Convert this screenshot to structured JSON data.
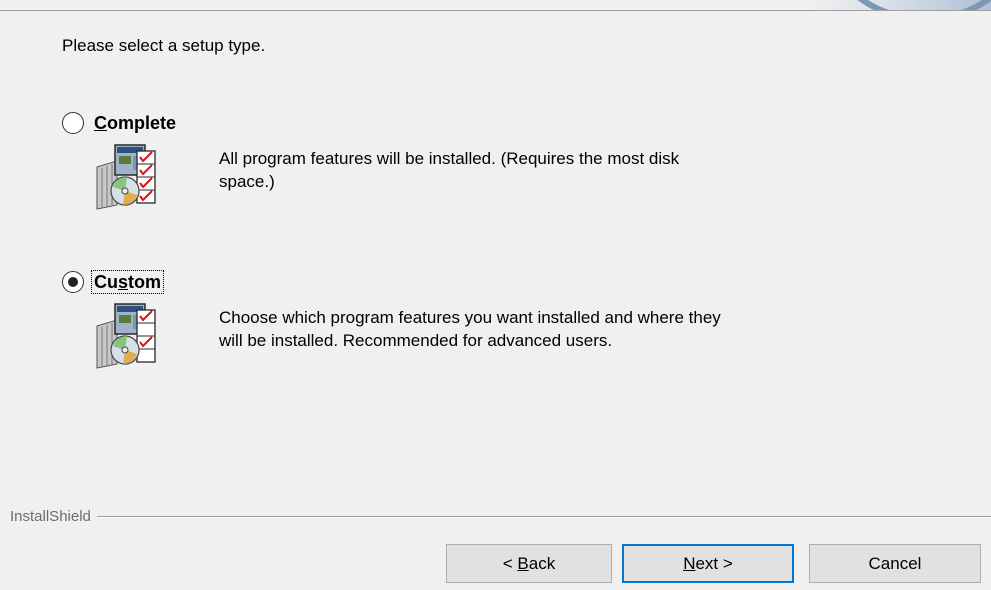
{
  "header": {
    "accent_color": "#7f97b7"
  },
  "prompt": "Please select a setup type.",
  "options": [
    {
      "id": "complete",
      "mnemonic": "C",
      "label_rest": "omplete",
      "selected": false,
      "icon": "setup-package-icon",
      "description": "All program features will be installed. (Requires the most disk",
      "description_line2": "space.)"
    },
    {
      "id": "custom",
      "label_pre": "Cu",
      "mnemonic": "s",
      "label_rest": "tom",
      "selected": true,
      "icon": "setup-package-icon",
      "description": "Choose which program features you want installed and where they",
      "description_line2": "will be installed. Recommended for advanced users."
    }
  ],
  "branding": "InstallShield",
  "buttons": {
    "back_pre": "< ",
    "back_mnemonic": "B",
    "back_rest": "ack",
    "next_mnemonic": "N",
    "next_rest": "ext >",
    "cancel": "Cancel",
    "focus_color": "#0078d7"
  }
}
